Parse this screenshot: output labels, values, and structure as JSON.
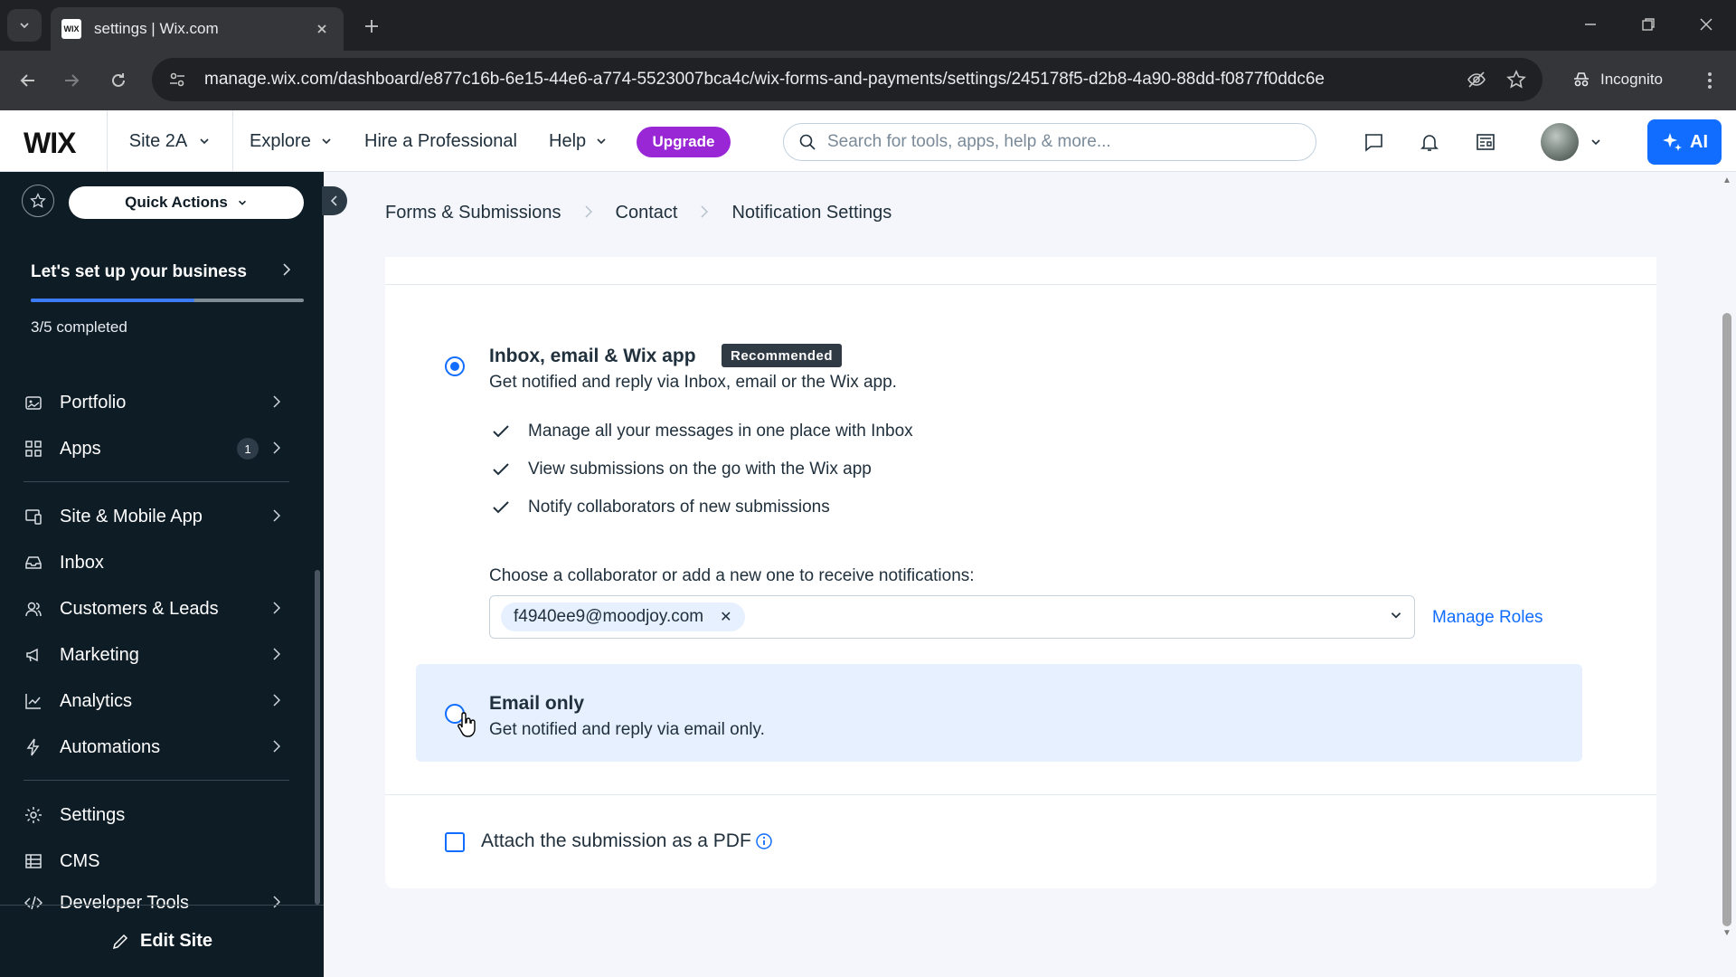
{
  "browser": {
    "tab_title": "settings | Wix.com",
    "favicon_text": "WIX",
    "url": "manage.wix.com/dashboard/e877c16b-6e15-44e6-a774-5523007bca4c/wix-forms-and-payments/settings/245178f5-d2b8-4a90-88dd-f0877f0ddc6e",
    "incognito_label": "Incognito"
  },
  "topbar": {
    "logo": "WIX",
    "site_name": "Site 2A",
    "nav": [
      "Explore",
      "Hire a Professional",
      "Help"
    ],
    "upgrade_label": "Upgrade",
    "search_placeholder": "Search for tools, apps, help & more...",
    "ai_label": "AI"
  },
  "sidebar": {
    "quick_actions_label": "Quick Actions",
    "setup": {
      "title": "Let's set up your business",
      "progress_text": "3/5 completed",
      "progress": 0.6
    },
    "items": [
      {
        "label": "Portfolio",
        "icon": "portfolio-icon",
        "chevron": true
      },
      {
        "label": "Apps",
        "icon": "apps-icon",
        "chevron": true,
        "badge": "1"
      },
      {
        "label": "Site & Mobile App",
        "icon": "site-mobile-icon",
        "chevron": true
      },
      {
        "label": "Inbox",
        "icon": "inbox-icon",
        "chevron": false
      },
      {
        "label": "Customers & Leads",
        "icon": "customers-icon",
        "chevron": true
      },
      {
        "label": "Marketing",
        "icon": "marketing-icon",
        "chevron": true
      },
      {
        "label": "Analytics",
        "icon": "analytics-icon",
        "chevron": true
      },
      {
        "label": "Automations",
        "icon": "automations-icon",
        "chevron": true
      },
      {
        "label": "Settings",
        "icon": "settings-icon",
        "chevron": false
      },
      {
        "label": "CMS",
        "icon": "cms-icon",
        "chevron": false
      },
      {
        "label": "Developer Tools",
        "icon": "developer-tools-icon",
        "chevron": true
      }
    ],
    "edit_site_label": "Edit Site"
  },
  "breadcrumb": [
    "Forms & Submissions",
    "Contact",
    "Notification Settings"
  ],
  "main": {
    "option_inbox": {
      "title": "Inbox, email & Wix app",
      "badge": "Recommended",
      "description": "Get notified and reply via Inbox, email or the Wix app.",
      "selected": true,
      "features": [
        "Manage all your messages in one place with Inbox",
        "View submissions on the go with the Wix app",
        "Notify collaborators of new submissions"
      ],
      "collaborator_label": "Choose a collaborator or add a new one to receive notifications:",
      "collaborator_chip": "f4940ee9@moodjoy.com",
      "manage_roles_label": "Manage Roles"
    },
    "option_email": {
      "title": "Email only",
      "description": "Get notified and reply via email only.",
      "selected": false
    },
    "pdf_checkbox": {
      "label": "Attach the submission as a PDF",
      "checked": false
    }
  },
  "colors": {
    "accent": "#116dff",
    "upgrade": "#9a27d5",
    "sidebar_bg": "#0e1c26",
    "highlight": "#e7f0ff"
  }
}
